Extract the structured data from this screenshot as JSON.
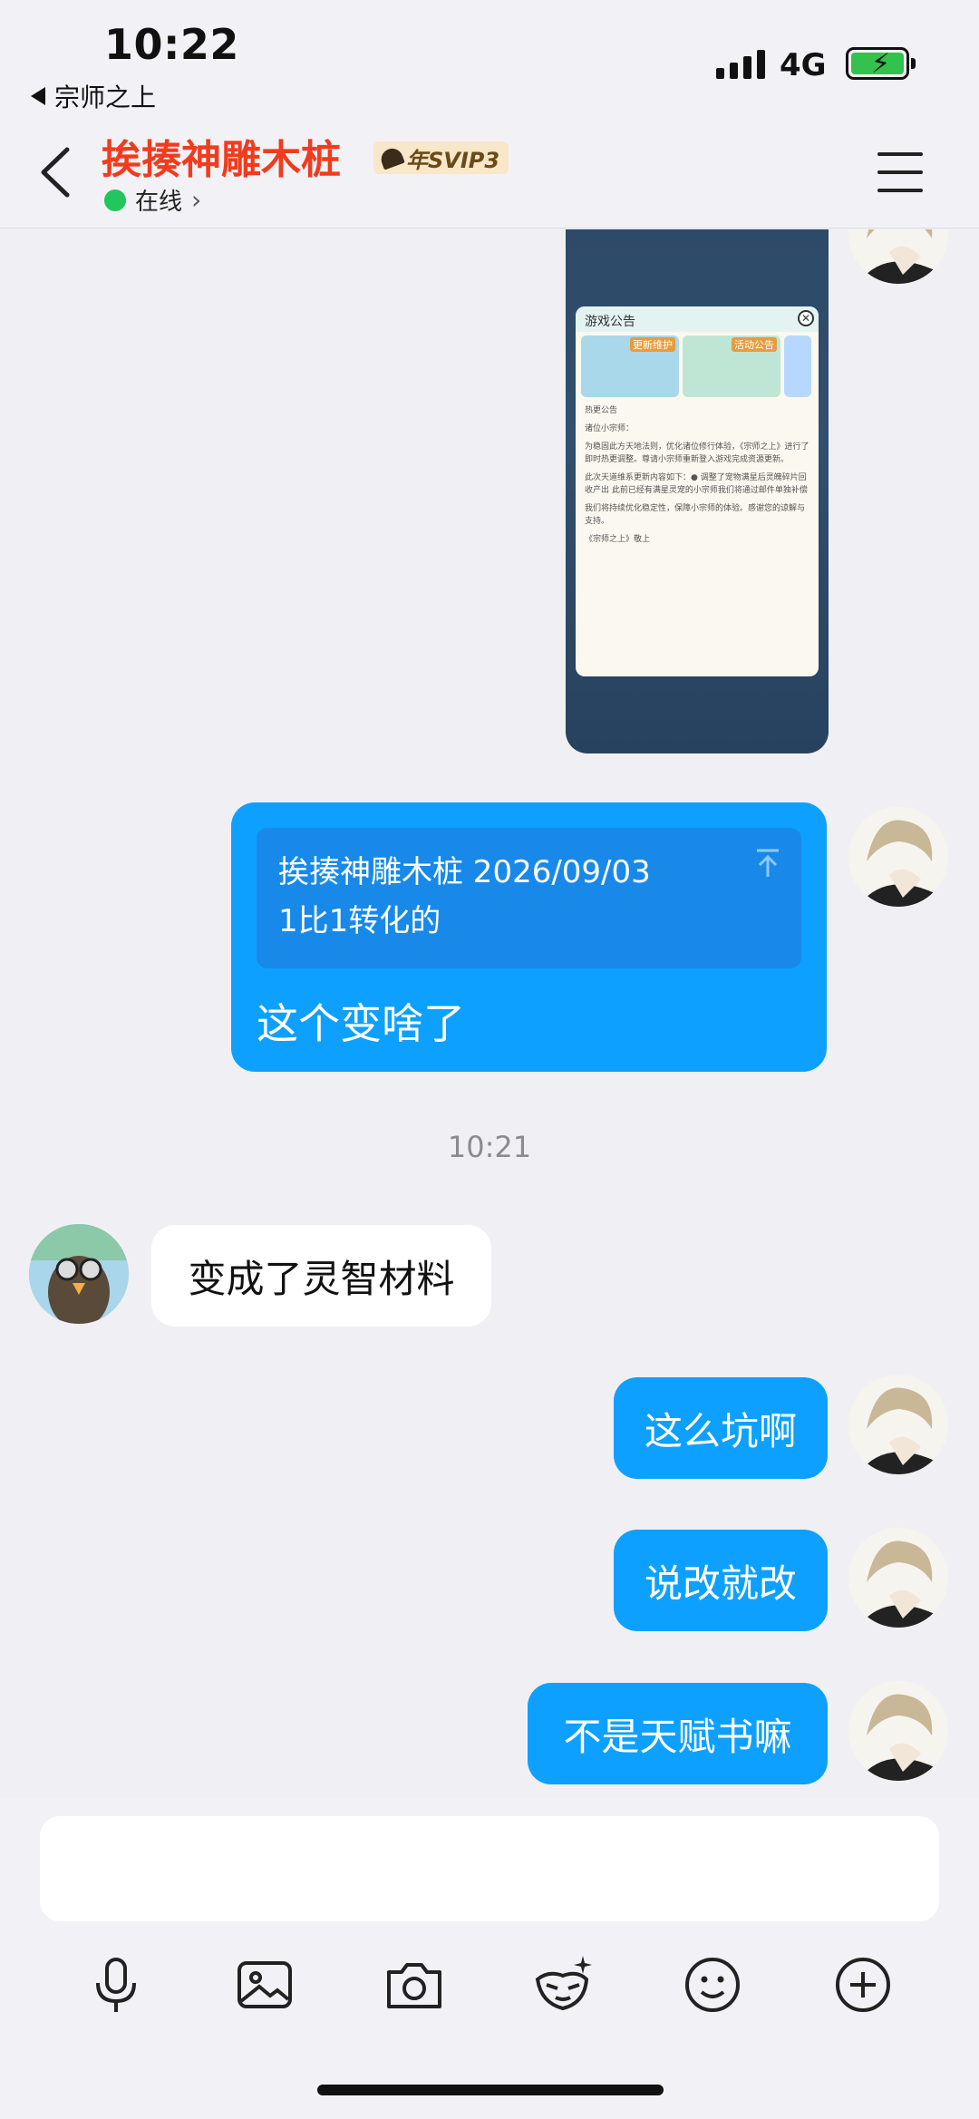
{
  "status_bar": {
    "time": "10:22",
    "back_app": "宗师之上",
    "network": "4G"
  },
  "header": {
    "contact_name": "挨揍神雕木桩",
    "vip_badge": "年SVIP3",
    "status": "在线"
  },
  "messages": {
    "image_notice": {
      "title": "游戏公告",
      "tab1": "更新维护",
      "tab2": "活动公告",
      "heading": "热更公告",
      "greeting": "诸位小宗师：",
      "p1": "为稳固此方天地法则，优化诸位修行体验，《宗师之上》进行了即时热更调整。尊请小宗师重新登入游戏完成资源更新。",
      "p2": "此次天道维系更新内容如下：● 调整了宠物满星后灵魄碎片回收产出 此前已经有满星灵宠的小宗师我们将通过邮件单独补偿",
      "p3": "我们将持续优化稳定性，保障小宗师的体验。感谢您的谅解与支持。",
      "sign": "《宗师之上》敬上"
    },
    "quote": {
      "line1": "挨揍神雕木桩 2026/09/03",
      "line2": "1比1转化的",
      "reply": "这个变啥了"
    },
    "timestamp": "10:21",
    "incoming_1": "变成了灵智材料",
    "outgoing_1": "这么坑啊",
    "outgoing_2": "说改就改",
    "outgoing_3": "不是天赋书嘛"
  },
  "input": {
    "placeholder": ""
  },
  "toolbar": {
    "icons": [
      "microphone-icon",
      "image-icon",
      "camera-icon",
      "face-sticker-icon",
      "emoji-icon",
      "plus-icon"
    ]
  },
  "colors": {
    "accent": "#0ea0ff",
    "title_red": "#f03c1e",
    "online_green": "#21c65c"
  }
}
